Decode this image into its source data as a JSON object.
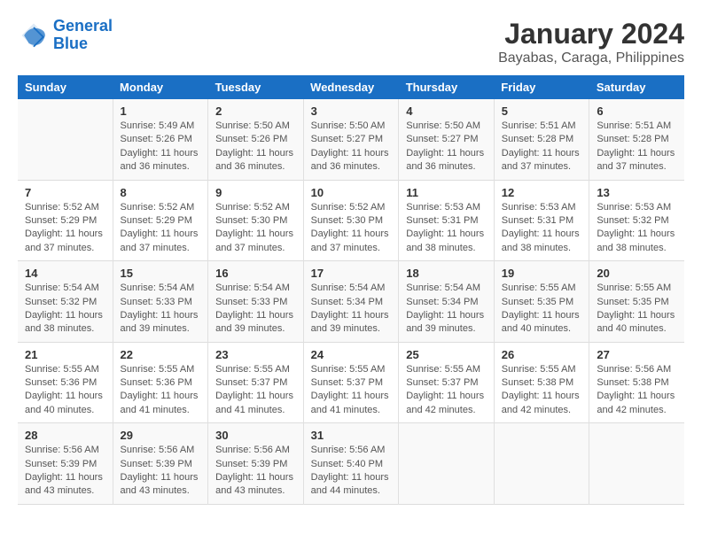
{
  "logo": {
    "line1": "General",
    "line2": "Blue"
  },
  "title": "January 2024",
  "subtitle": "Bayabas, Caraga, Philippines",
  "days_header": [
    "Sunday",
    "Monday",
    "Tuesday",
    "Wednesday",
    "Thursday",
    "Friday",
    "Saturday"
  ],
  "weeks": [
    [
      {
        "day": "",
        "info": ""
      },
      {
        "day": "1",
        "info": "Sunrise: 5:49 AM\nSunset: 5:26 PM\nDaylight: 11 hours\nand 36 minutes."
      },
      {
        "day": "2",
        "info": "Sunrise: 5:50 AM\nSunset: 5:26 PM\nDaylight: 11 hours\nand 36 minutes."
      },
      {
        "day": "3",
        "info": "Sunrise: 5:50 AM\nSunset: 5:27 PM\nDaylight: 11 hours\nand 36 minutes."
      },
      {
        "day": "4",
        "info": "Sunrise: 5:50 AM\nSunset: 5:27 PM\nDaylight: 11 hours\nand 36 minutes."
      },
      {
        "day": "5",
        "info": "Sunrise: 5:51 AM\nSunset: 5:28 PM\nDaylight: 11 hours\nand 37 minutes."
      },
      {
        "day": "6",
        "info": "Sunrise: 5:51 AM\nSunset: 5:28 PM\nDaylight: 11 hours\nand 37 minutes."
      }
    ],
    [
      {
        "day": "7",
        "info": "Sunrise: 5:52 AM\nSunset: 5:29 PM\nDaylight: 11 hours\nand 37 minutes."
      },
      {
        "day": "8",
        "info": "Sunrise: 5:52 AM\nSunset: 5:29 PM\nDaylight: 11 hours\nand 37 minutes."
      },
      {
        "day": "9",
        "info": "Sunrise: 5:52 AM\nSunset: 5:30 PM\nDaylight: 11 hours\nand 37 minutes."
      },
      {
        "day": "10",
        "info": "Sunrise: 5:52 AM\nSunset: 5:30 PM\nDaylight: 11 hours\nand 37 minutes."
      },
      {
        "day": "11",
        "info": "Sunrise: 5:53 AM\nSunset: 5:31 PM\nDaylight: 11 hours\nand 38 minutes."
      },
      {
        "day": "12",
        "info": "Sunrise: 5:53 AM\nSunset: 5:31 PM\nDaylight: 11 hours\nand 38 minutes."
      },
      {
        "day": "13",
        "info": "Sunrise: 5:53 AM\nSunset: 5:32 PM\nDaylight: 11 hours\nand 38 minutes."
      }
    ],
    [
      {
        "day": "14",
        "info": "Sunrise: 5:54 AM\nSunset: 5:32 PM\nDaylight: 11 hours\nand 38 minutes."
      },
      {
        "day": "15",
        "info": "Sunrise: 5:54 AM\nSunset: 5:33 PM\nDaylight: 11 hours\nand 39 minutes."
      },
      {
        "day": "16",
        "info": "Sunrise: 5:54 AM\nSunset: 5:33 PM\nDaylight: 11 hours\nand 39 minutes."
      },
      {
        "day": "17",
        "info": "Sunrise: 5:54 AM\nSunset: 5:34 PM\nDaylight: 11 hours\nand 39 minutes."
      },
      {
        "day": "18",
        "info": "Sunrise: 5:54 AM\nSunset: 5:34 PM\nDaylight: 11 hours\nand 39 minutes."
      },
      {
        "day": "19",
        "info": "Sunrise: 5:55 AM\nSunset: 5:35 PM\nDaylight: 11 hours\nand 40 minutes."
      },
      {
        "day": "20",
        "info": "Sunrise: 5:55 AM\nSunset: 5:35 PM\nDaylight: 11 hours\nand 40 minutes."
      }
    ],
    [
      {
        "day": "21",
        "info": "Sunrise: 5:55 AM\nSunset: 5:36 PM\nDaylight: 11 hours\nand 40 minutes."
      },
      {
        "day": "22",
        "info": "Sunrise: 5:55 AM\nSunset: 5:36 PM\nDaylight: 11 hours\nand 41 minutes."
      },
      {
        "day": "23",
        "info": "Sunrise: 5:55 AM\nSunset: 5:37 PM\nDaylight: 11 hours\nand 41 minutes."
      },
      {
        "day": "24",
        "info": "Sunrise: 5:55 AM\nSunset: 5:37 PM\nDaylight: 11 hours\nand 41 minutes."
      },
      {
        "day": "25",
        "info": "Sunrise: 5:55 AM\nSunset: 5:37 PM\nDaylight: 11 hours\nand 42 minutes."
      },
      {
        "day": "26",
        "info": "Sunrise: 5:55 AM\nSunset: 5:38 PM\nDaylight: 11 hours\nand 42 minutes."
      },
      {
        "day": "27",
        "info": "Sunrise: 5:56 AM\nSunset: 5:38 PM\nDaylight: 11 hours\nand 42 minutes."
      }
    ],
    [
      {
        "day": "28",
        "info": "Sunrise: 5:56 AM\nSunset: 5:39 PM\nDaylight: 11 hours\nand 43 minutes."
      },
      {
        "day": "29",
        "info": "Sunrise: 5:56 AM\nSunset: 5:39 PM\nDaylight: 11 hours\nand 43 minutes."
      },
      {
        "day": "30",
        "info": "Sunrise: 5:56 AM\nSunset: 5:39 PM\nDaylight: 11 hours\nand 43 minutes."
      },
      {
        "day": "31",
        "info": "Sunrise: 5:56 AM\nSunset: 5:40 PM\nDaylight: 11 hours\nand 44 minutes."
      },
      {
        "day": "",
        "info": ""
      },
      {
        "day": "",
        "info": ""
      },
      {
        "day": "",
        "info": ""
      }
    ]
  ]
}
